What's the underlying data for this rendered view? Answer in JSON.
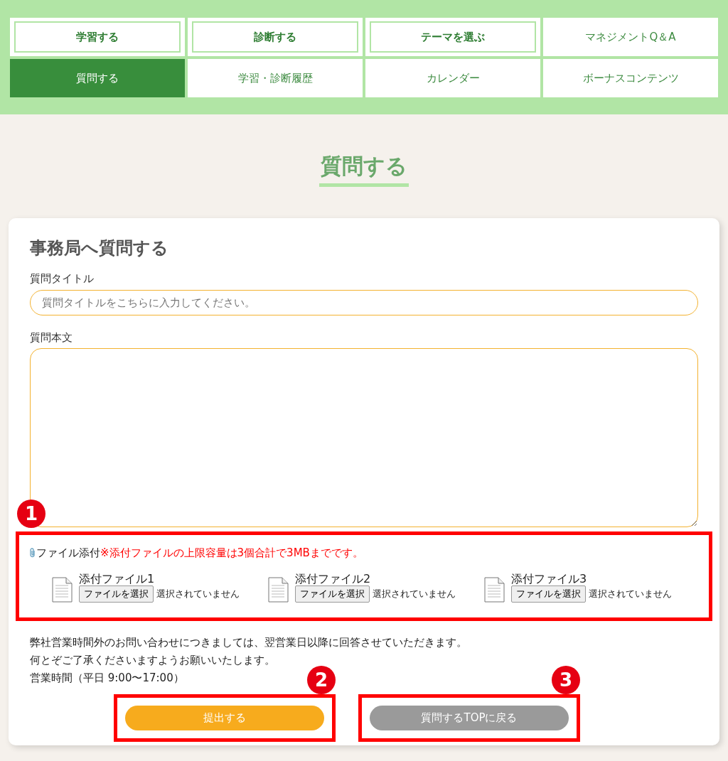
{
  "nav": [
    {
      "label": "学習する",
      "kind": "featured",
      "selected": false
    },
    {
      "label": "診断する",
      "kind": "featured",
      "selected": false
    },
    {
      "label": "テーマを選ぶ",
      "kind": "featured",
      "selected": false
    },
    {
      "label": "マネジメントQ＆A",
      "kind": "plain",
      "selected": false
    },
    {
      "label": "質問する",
      "kind": "plain",
      "selected": true
    },
    {
      "label": "学習・診断履歴",
      "kind": "plain",
      "selected": false
    },
    {
      "label": "カレンダー",
      "kind": "plain",
      "selected": false
    },
    {
      "label": "ボーナスコンテンツ",
      "kind": "plain",
      "selected": false
    }
  ],
  "page_title": "質問する",
  "form": {
    "heading": "事務局へ質問する",
    "title_label": "質問タイトル",
    "title_placeholder": "質問タイトルをこちらに入力してください。",
    "body_label": "質問本文",
    "attach_label": "ファイル添付",
    "attach_note": "※添付ファイルの上限容量は3個合計で3MBまでです。",
    "files": [
      {
        "label": "添付ファイル1",
        "button": "ファイルを選択",
        "status": "選択されていません"
      },
      {
        "label": "添付ファイル2",
        "button": "ファイルを選択",
        "status": "選択されていません"
      },
      {
        "label": "添付ファイル3",
        "button": "ファイルを選択",
        "status": "選択されていません"
      }
    ],
    "notice": [
      "弊社営業時間外のお問い合わせにつきましては、翌営業日以降に回答させていただきます。",
      "何とぞご了承くださいますようお願いいたします。",
      "営業時間（平日 9:00〜17:00）"
    ],
    "submit": "提出する",
    "back": "質問するTOPに戻る"
  },
  "annotations": [
    "1",
    "2",
    "3"
  ]
}
